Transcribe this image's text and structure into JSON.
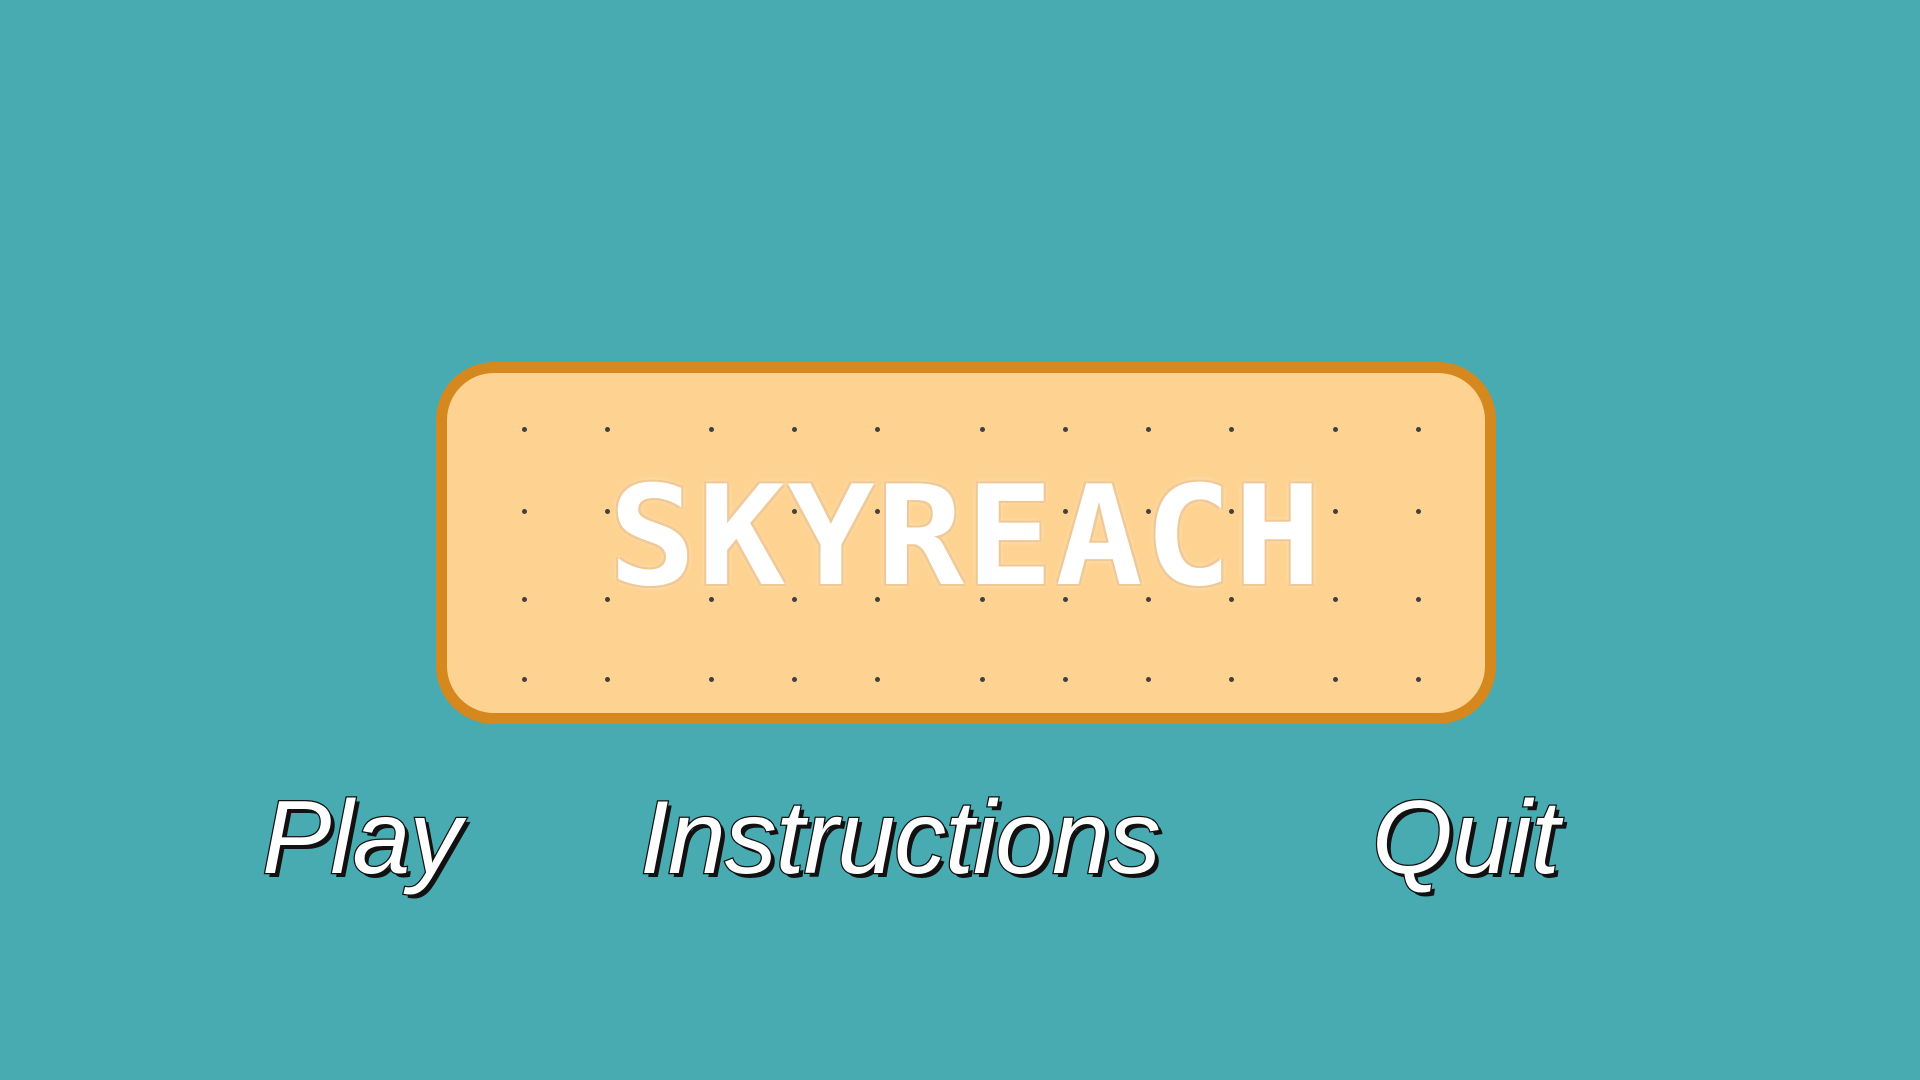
{
  "background_color": "#48abb2",
  "logo": {
    "title": "SKYREACH",
    "panel_color": "#fed391",
    "border_color": "#d4881d",
    "text_color": "#ffffff"
  },
  "menu": {
    "items": [
      {
        "id": "play",
        "label": "Play"
      },
      {
        "id": "instructions",
        "label": "Instructions"
      },
      {
        "id": "quit",
        "label": "Quit"
      }
    ]
  }
}
